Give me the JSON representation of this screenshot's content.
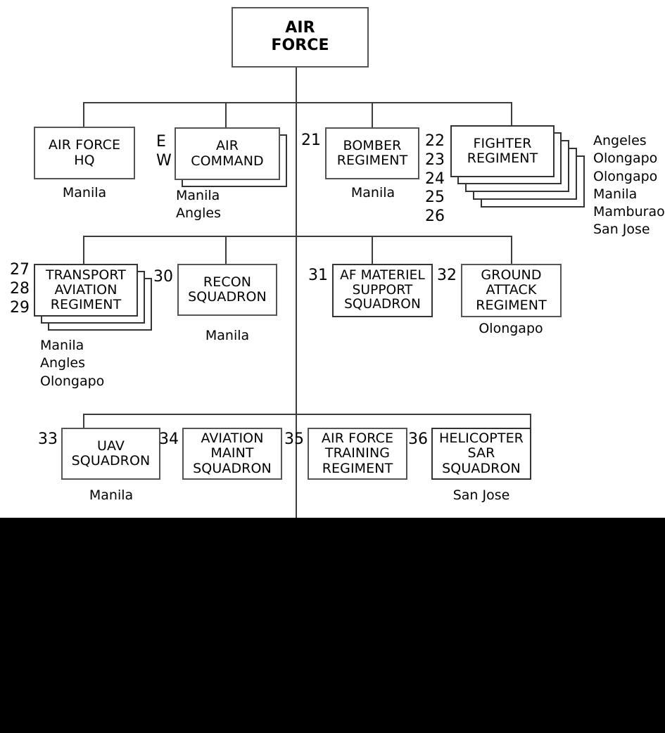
{
  "diagram": {
    "title": "AIR FORCE",
    "root": {
      "label": "AIR\nFORCE"
    },
    "side_letters": "E\nW",
    "rows": [
      {
        "nodes": [
          {
            "label": "AIR FORCE\nHQ",
            "index": "",
            "stack": 1,
            "locations": "Manila"
          },
          {
            "label": "AIR\nCOMMAND",
            "index": "",
            "stack": 2,
            "locations": "Manila\nAngles"
          },
          {
            "label": "BOMBER\nREGIMENT",
            "index": "21",
            "stack": 1,
            "locations": "Manila"
          },
          {
            "label": "FIGHTER\nREGIMENT",
            "index": "22\n23\n24\n25\n26",
            "stack": 5,
            "locations": "Angeles\nOlongapo\nOlongapo\nManila\nMamburao\nSan Jose"
          }
        ]
      },
      {
        "nodes": [
          {
            "label": "TRANSPORT\nAVIATION\nREGIMENT",
            "index": "27\n28\n29",
            "stack": 3,
            "locations": "Manila\nAngles\nOlongapo"
          },
          {
            "label": "RECON\nSQUADRON",
            "index": "30",
            "stack": 1,
            "locations": "Manila"
          },
          {
            "label": "AF MATERIEL\nSUPPORT\nSQUADRON",
            "index": "31",
            "stack": 1,
            "locations": ""
          },
          {
            "label": "GROUND\nATTACK\nREGIMENT",
            "index": "32",
            "stack": 1,
            "locations": "Olongapo"
          }
        ]
      },
      {
        "nodes": [
          {
            "label": "UAV\nSQUADRON",
            "index": "33",
            "stack": 1,
            "locations": "Manila"
          },
          {
            "label": "AVIATION\nMAINT\nSQUADRON",
            "index": "34",
            "stack": 1,
            "locations": ""
          },
          {
            "label": "AIR FORCE\nTRAINING\nREGIMENT",
            "index": "35",
            "stack": 1,
            "locations": ""
          },
          {
            "label": "HELICOPTER\nSAR\nSQUADRON",
            "index": "36",
            "stack": 1,
            "locations": "San Jose"
          }
        ]
      }
    ],
    "colors": {
      "line": "#3d3d3d",
      "box_border": "#555555",
      "stack_border": "#333333",
      "text": "#000000",
      "background": "#ffffff",
      "band": "#000000"
    }
  }
}
